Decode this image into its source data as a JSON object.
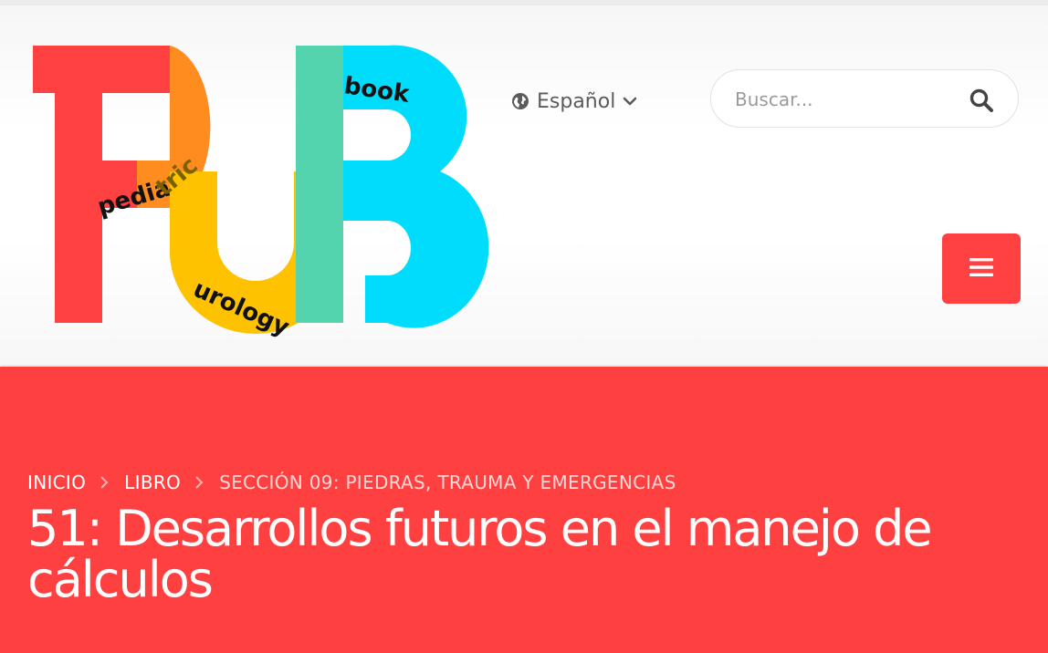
{
  "logo": {
    "letters": [
      "P",
      "U",
      "B"
    ],
    "words": {
      "pediatric_a": "pedia",
      "pediatric_b": "tric",
      "urology": "urology",
      "book": "book"
    },
    "colors": {
      "red": "#ff4141",
      "orange": "#ff8c1f",
      "yellow": "#ffc200",
      "green": "#54d4ae",
      "cyan": "#00dcfc"
    }
  },
  "language": {
    "label": "Español",
    "globe_icon": "globe-icon",
    "caret_icon": "chevron-down-icon"
  },
  "search": {
    "placeholder": "Buscar...",
    "value": "",
    "icon": "search-icon"
  },
  "menu": {
    "icon": "hamburger-icon",
    "color": "#ff4141"
  },
  "breadcrumb": {
    "items": [
      "INICIO",
      "LIBRO",
      "SECCIÓN 09: PIEDRAS, TRAUMA Y EMERGENCIAS"
    ]
  },
  "page": {
    "title": "51: Desarrollos futuros en el manejo de cálculos",
    "hero_color": "#ff4040"
  }
}
